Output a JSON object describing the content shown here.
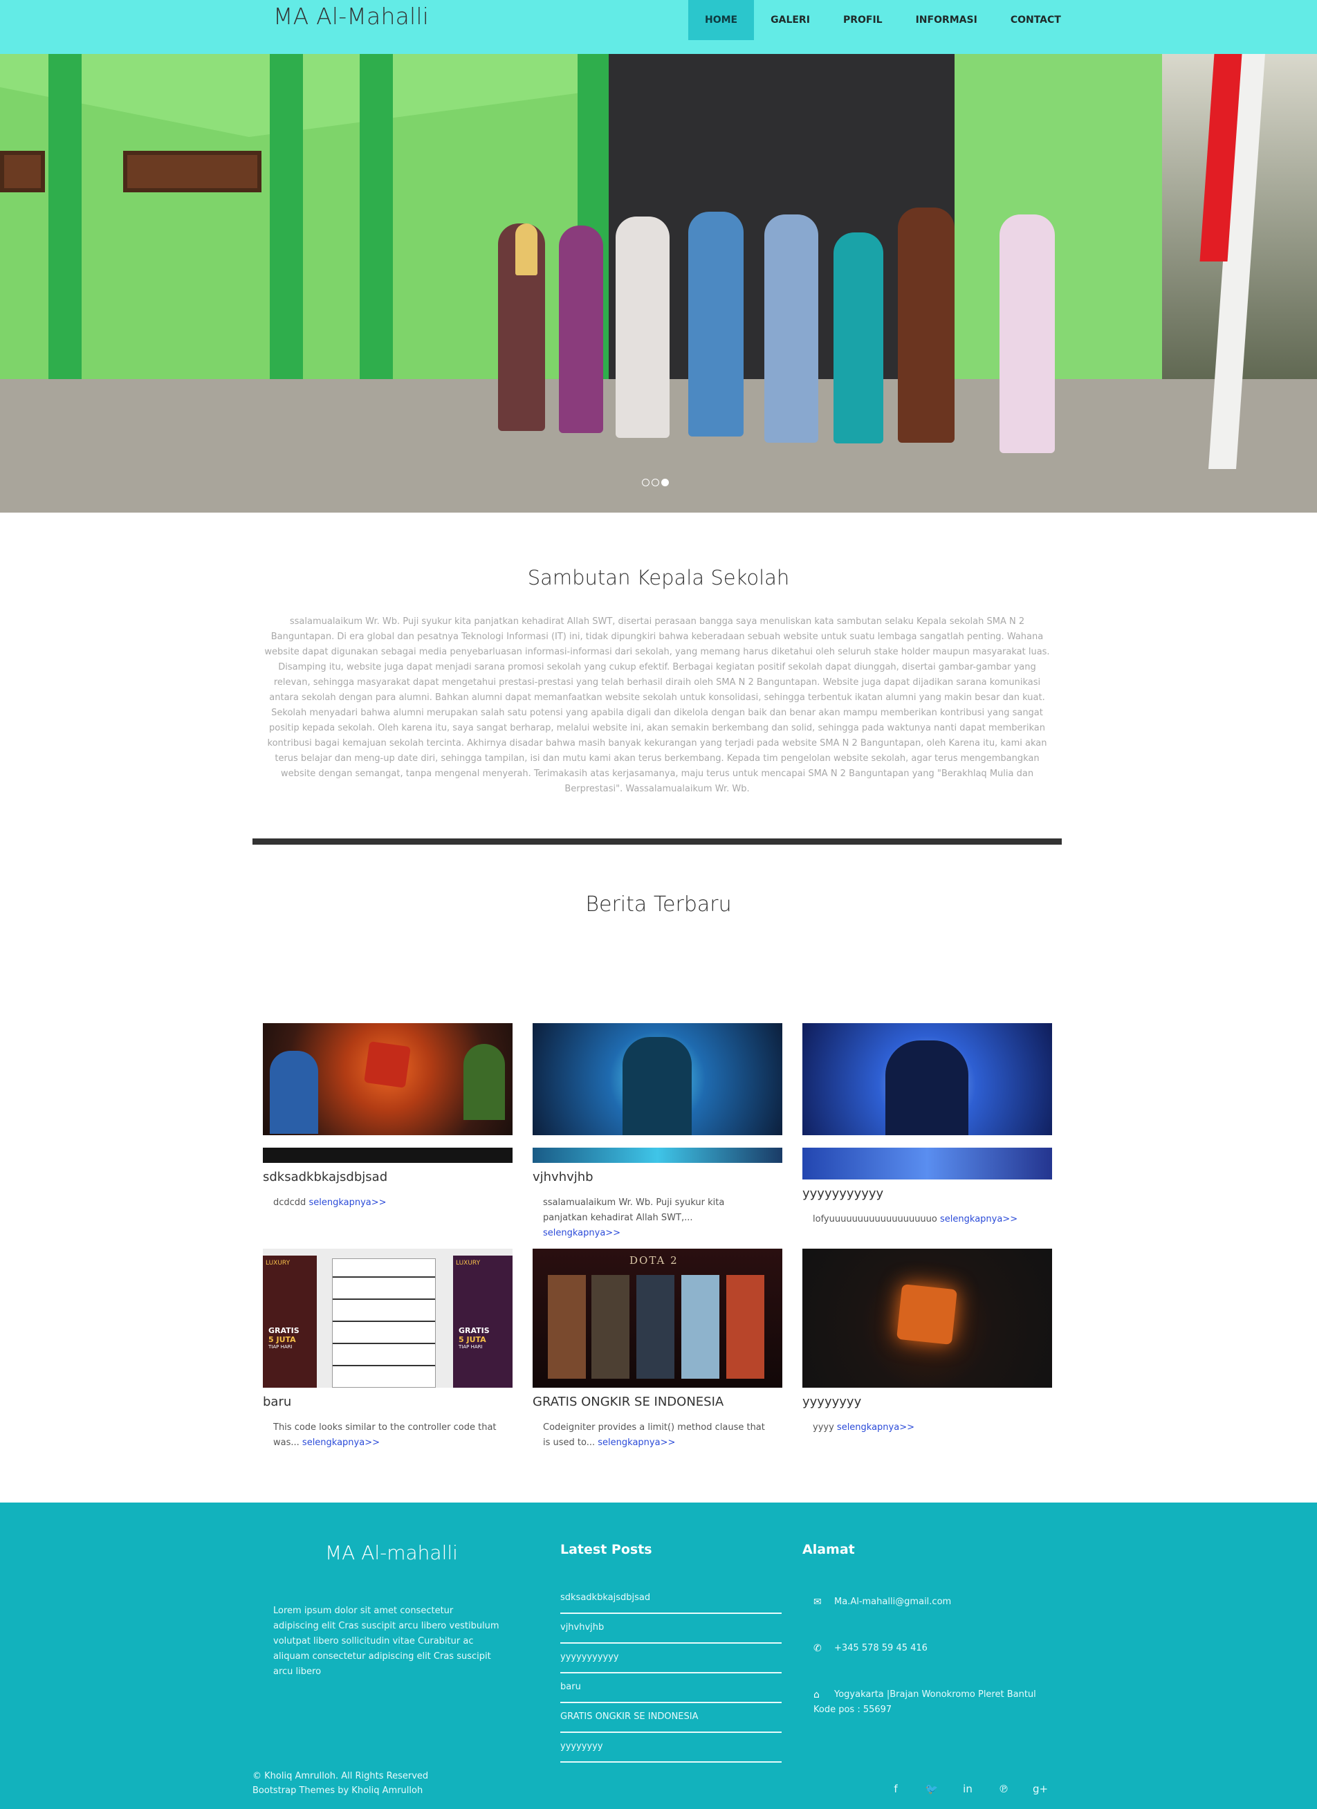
{
  "navbar": {
    "brand": "MA Al-Mahalli",
    "items": [
      {
        "label": "HOME",
        "active": true
      },
      {
        "label": "GALERI",
        "active": false
      },
      {
        "label": "PROFIL",
        "active": false
      },
      {
        "label": "INFORMASI",
        "active": false
      },
      {
        "label": "CONTACT",
        "active": false
      }
    ],
    "accent_color": "#63ebe6"
  },
  "hero": {
    "slide_count": 3,
    "active_slide": 3
  },
  "sambutan": {
    "title": "Sambutan Kepala Sekolah",
    "text": "ssalamualaikum Wr. Wb. Puji syukur kita panjatkan kehadirat Allah SWT, disertai perasaan bangga saya menuliskan kata sambutan selaku Kepala sekolah SMA N 2 Banguntapan. Di era global dan pesatnya Teknologi Informasi (IT) ini, tidak dipungkiri bahwa keberadaan sebuah website untuk suatu lembaga sangatlah penting. Wahana website dapat digunakan sebagai media penyebarluasan informasi-informasi dari sekolah, yang memang harus diketahui oleh seluruh stake holder maupun masyarakat luas. Disamping itu, website juga dapat menjadi sarana promosi sekolah yang cukup efektif. Berbagai kegiatan positif sekolah dapat diunggah, disertai gambar-gambar yang relevan, sehingga masyarakat dapat mengetahui prestasi-prestasi yang telah berhasil diraih oleh SMA N 2 Banguntapan. Website juga dapat dijadikan sarana komunikasi antara sekolah dengan para alumni. Bahkan alumni dapat memanfaatkan website sekolah untuk konsolidasi, sehingga terbentuk ikatan alumni yang makin besar dan kuat. Sekolah menyadari bahwa alumni merupakan salah satu potensi yang apabila digali dan dikelola dengan baik dan benar akan mampu memberikan kontribusi yang sangat positip kepada sekolah. Oleh karena itu, saya sangat berharap, melalui website ini, akan semakin berkembang dan solid, sehingga pada waktunya nanti dapat memberikan kontribusi bagai kemajuan sekolah tercinta. Akhirnya disadar bahwa masih banyak kekurangan yang terjadi pada website SMA N 2 Banguntapan, oleh Karena itu, kami akan terus belajar dan meng-up date diri, sehingga tampilan, isi dan mutu kami akan terus berkembang. Kepada tim pengelolan website sekolah, agar terus mengembangkan website dengan semangat, tanpa mengenal menyerah. Terimakasih atas kerjasamanya, maju terus untuk mencapai SMA N 2 Banguntapan yang \"Berakhlaq Mulia dan Berprestasi\". Wassalamualaikum Wr. Wb."
  },
  "berita": {
    "title": "Berita Terbaru",
    "more_label": "selengkapnya>>",
    "cards": [
      {
        "title": "sdksadkbkajsdbjsad",
        "excerpt": "dcdcdd"
      },
      {
        "title": "vjhvhvjhb",
        "excerpt": "ssalamualaikum Wr. Wb. Puji syukur kita panjatkan kehadirat Allah SWT,..."
      },
      {
        "title": "yyyyyyyyyyy",
        "excerpt": "lofyuuuuuuuuuuuuuuuuuuo"
      },
      {
        "title": "baru",
        "excerpt": "This code looks similar to the controller code that was..."
      },
      {
        "title": "GRATIS ONGKIR SE INDONESIA",
        "excerpt": "Codeigniter provides a limit() method clause that is used to..."
      },
      {
        "title": "yyyyyyyy",
        "excerpt": "yyyy"
      }
    ],
    "thumb_texts": {
      "dota_logo": "DOTA 2",
      "luxury": "LUXURY",
      "gratis": "GRATIS",
      "juta": "5 JUTA",
      "tiap_hari": "TIAP HARI"
    }
  },
  "footer": {
    "brand": "MA Al-mahalli",
    "lorem": "Lorem ipsum dolor sit amet consectetur adipiscing elit Cras suscipit arcu libero vestibulum volutpat libero sollicitudin vitae Curabitur ac aliquam consectetur adipiscing elit Cras suscipit arcu libero",
    "latest_heading": "Latest Posts",
    "latest_posts": [
      "sdksadkbkajsdbjsad",
      "vjhvhvjhb",
      "yyyyyyyyyyy",
      "baru",
      "GRATIS ONGKIR SE INDONESIA",
      "yyyyyyyy"
    ],
    "alamat_heading": "Alamat",
    "email": "Ma.Al-mahalli@gmail.com",
    "phone": "+345 578 59 45 416",
    "address_line1": "Yogyakarta |Brajan Wonokromo Pleret Bantul",
    "address_line2": "Kode pos : 55697",
    "copyright": "© Kholiq Amrulloh. All Rights Reserved",
    "credit": "Bootstrap Themes by Kholiq Amrulloh",
    "social_icons": [
      "facebook-icon",
      "twitter-icon",
      "linkedin-icon",
      "pinterest-icon",
      "google-plus-icon"
    ],
    "bg_color": "#12b2bd"
  }
}
